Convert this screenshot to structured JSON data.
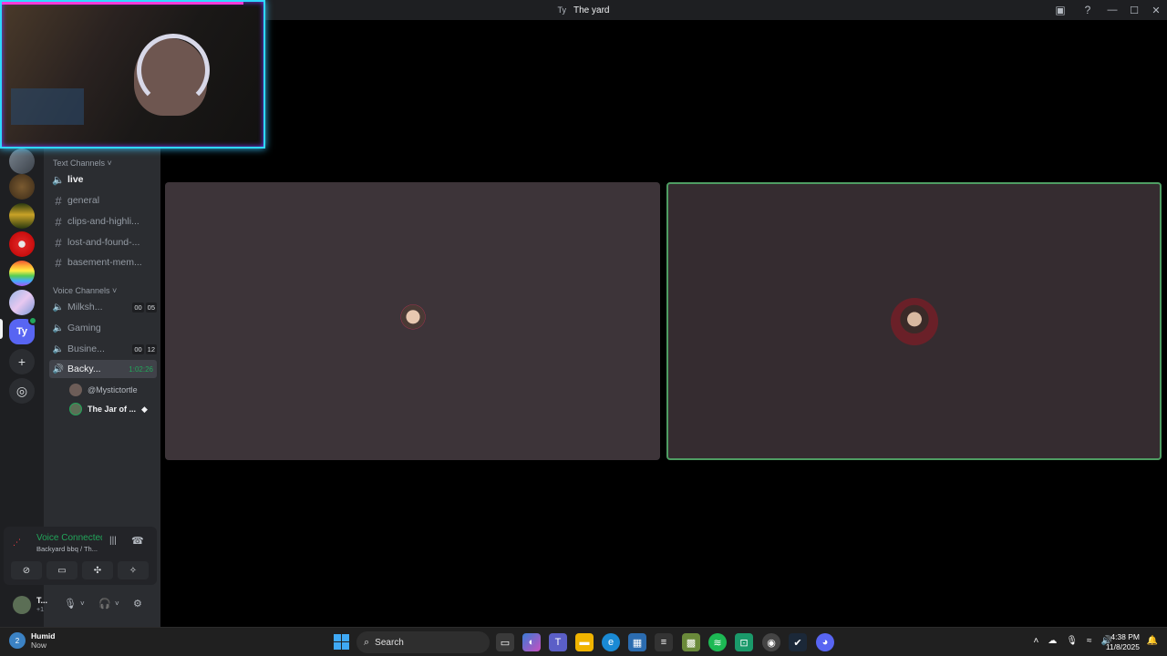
{
  "titlebar": {
    "server_tag": "Ty",
    "title": "The yard"
  },
  "channels": {
    "text_category": "Text Channels",
    "voice_category": "Voice Channels",
    "text": [
      {
        "label": "live"
      },
      {
        "label": "general"
      },
      {
        "label": "clips-and-highli..."
      },
      {
        "label": "lost-and-found-..."
      },
      {
        "label": "basement-mem..."
      }
    ],
    "voice": [
      {
        "label": "Milksh...",
        "count_a": "00",
        "count_b": "05"
      },
      {
        "label": "Gaming"
      },
      {
        "label": "Busine...",
        "count_a": "00",
        "count_b": "12"
      },
      {
        "label": "Backy...",
        "timer": "1:02:26"
      }
    ],
    "voice_users": [
      {
        "name": "@Mystictortle"
      },
      {
        "name": "The Jar of ..."
      }
    ]
  },
  "servers": {
    "active_tag": "Ty",
    "add_icon": "plus-icon",
    "explore_icon": "compass-icon"
  },
  "voice_panel": {
    "status": "Voice Connected",
    "channel": "Backyard bbq / Th..."
  },
  "userbar": {
    "name": "T...",
    "sub": "+1"
  },
  "taskbar": {
    "weather_badge": "2",
    "weather_title": "Humid",
    "weather_sub": "Now",
    "search_label": "Search",
    "time": "4:38 PM",
    "date": "11/8/2025"
  },
  "colors": {
    "accent_green": "#23a55a",
    "speaking_border": "#4f9d63",
    "brand": "#5865f2",
    "cam_border": "#2fd8ff"
  }
}
